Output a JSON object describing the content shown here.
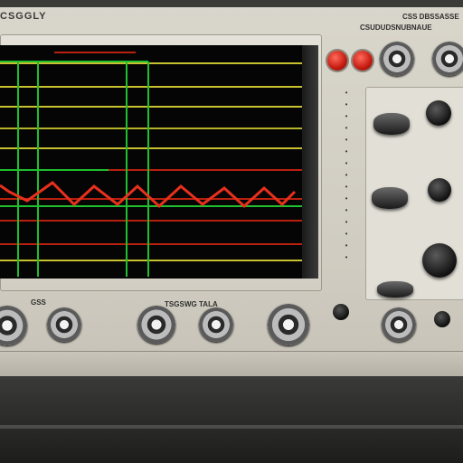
{
  "front_panel": {
    "brand": "CSGGLY",
    "model": "CSS DBSSASSE",
    "model_sub": "CSUDUDSNUBNAUE",
    "bottom_label_1": "GSS",
    "bottom_label_2": "TSGS",
    "bottom_label_3": "WG TALA"
  },
  "trace": {
    "color": "#e8301c",
    "grid_colors": [
      "#c7c130",
      "#1fbf2e",
      "#b8200f"
    ]
  },
  "icons": [
    "bnc-connector-icon",
    "knob-icon",
    "led-indicator-icon"
  ]
}
